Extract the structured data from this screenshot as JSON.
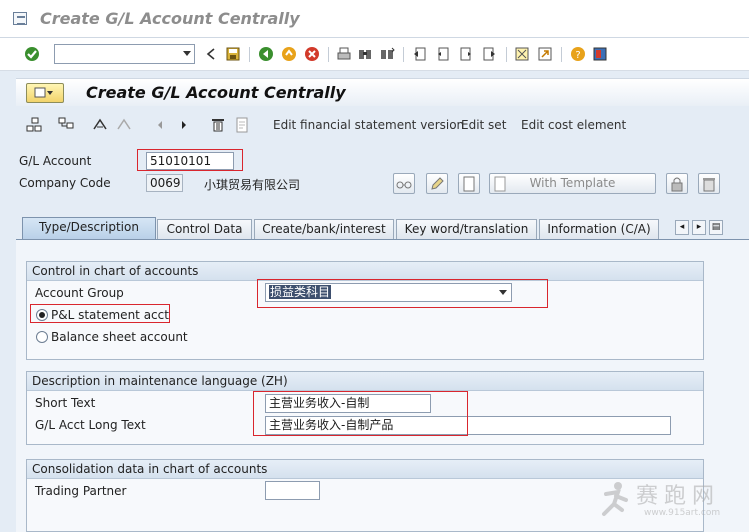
{
  "window": {
    "title": "Create G/L Account Centrally"
  },
  "system_toolbar": {
    "command_field": {
      "value": "",
      "placeholder": ""
    },
    "icons": [
      "enter-icon",
      "save-icon",
      "back-icon",
      "exit-icon",
      "cancel-icon",
      "print-icon",
      "find-icon",
      "find-next-icon",
      "first-page-icon",
      "previous-page-icon",
      "next-page-icon",
      "last-page-icon",
      "new-session-icon",
      "shortcut-icon",
      "help-icon",
      "customize-layout-icon"
    ]
  },
  "screen": {
    "title": "Create G/L Account Centrally"
  },
  "app_toolbar": {
    "edit_fs_version": "Edit financial statement version",
    "edit_set": "Edit set",
    "edit_cost_element": "Edit cost element"
  },
  "header": {
    "gl_account_label": "G/L Account",
    "gl_account_value": "51010101",
    "company_code_label": "Company Code",
    "company_code_value": "0069",
    "company_name": "小琪贸易有限公司",
    "with_template_label": "With Template"
  },
  "tabs": [
    {
      "label": "Type/Description",
      "active": true
    },
    {
      "label": "Control Data",
      "active": false
    },
    {
      "label": "Create/bank/interest",
      "active": false
    },
    {
      "label": "Key word/translation",
      "active": false
    },
    {
      "label": "Information (C/A)",
      "active": false
    }
  ],
  "groups": {
    "control": {
      "title": "Control in chart of accounts",
      "account_group_label": "Account Group",
      "account_group_value": "损益类科目",
      "radio_pl": "P&L statement acct",
      "radio_bs": "Balance sheet account",
      "selected": "pl"
    },
    "description": {
      "title": "Description in maintenance language (ZH)",
      "short_text_label": "Short Text",
      "short_text_value": "主营业务收入-自制",
      "long_text_label": "G/L Acct Long Text",
      "long_text_value": "主营业务收入-自制产品"
    },
    "consolidation": {
      "title": "Consolidation data in chart of accounts",
      "trading_partner_label": "Trading Partner",
      "trading_partner_value": ""
    }
  },
  "watermark": {
    "text": "赛跑网",
    "url": "www.915art.com"
  },
  "colors": {
    "highlight_box": "#d9262e",
    "tab_active": "#b9d0e8",
    "header_button": "#f2d36b"
  }
}
